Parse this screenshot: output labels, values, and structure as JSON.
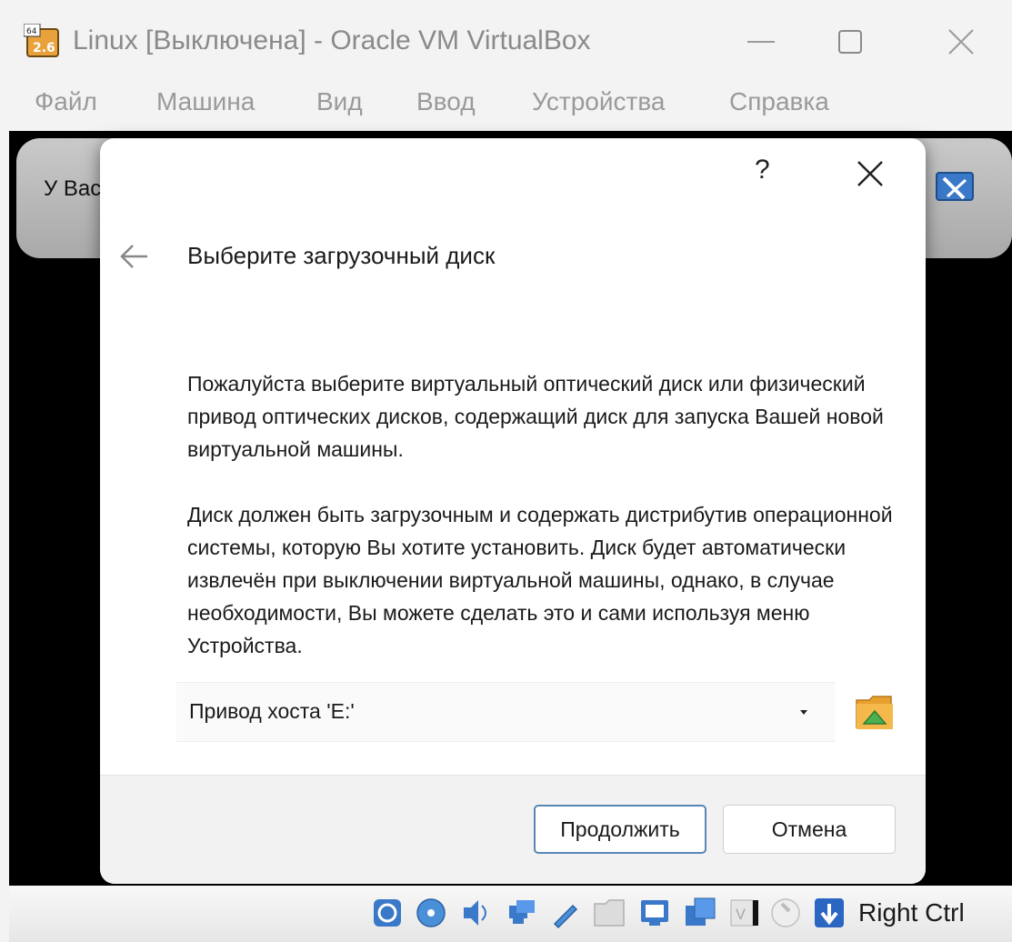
{
  "window": {
    "title": "Linux [Выключена] - Oracle VM VirtualBox",
    "app_icon": "virtualbox-linux-icon"
  },
  "menu": {
    "items": [
      "Файл",
      "Машина",
      "Вид",
      "Ввод",
      "Устройства",
      "Справка"
    ]
  },
  "vm": {
    "banner_text": "У Вас"
  },
  "dialog": {
    "help_label": "?",
    "heading": "Выберите загрузочный диск",
    "paragraph1": "Пожалуйста выберите виртуальный оптический диск или физический привод оптических дисков, содержащий диск для запуска Вашей новой виртуальной машины.",
    "paragraph2": "Диск должен быть загрузочным и содержать дистрибутив операционной системы, которую Вы хотите установить. Диск будет автоматически извлечён при выключении виртуальной машины, однако, в случае необходимости, Вы можете сделать это и сами используя меню Устройства.",
    "drive_selected": "Привод хоста 'E:'",
    "continue_label": "Продолжить",
    "cancel_label": "Отмена"
  },
  "statusbar": {
    "icons": [
      "hard-disk-icon",
      "optical-disk-icon",
      "audio-icon",
      "network-icon",
      "usb-icon",
      "shared-folders-icon",
      "display-icon",
      "video-capture-icon",
      "virtualization-icon",
      "mouse-integration-icon",
      "keyboard-capture-icon"
    ],
    "host_key": "Right Ctrl"
  },
  "colors": {
    "accent_border": "#5a86b4",
    "vm_background": "#000000",
    "dialog_bg": "#ffffff"
  }
}
